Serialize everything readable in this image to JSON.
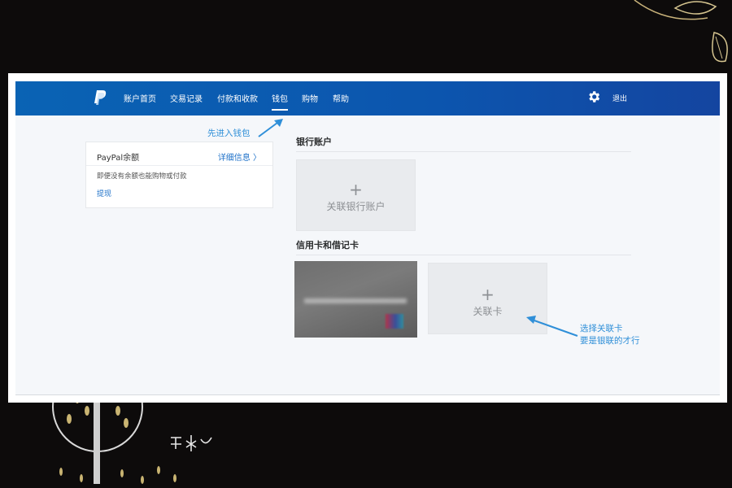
{
  "nav": {
    "items": [
      {
        "label": "账户首页"
      },
      {
        "label": "交易记录"
      },
      {
        "label": "付款和收款"
      },
      {
        "label": "钱包"
      },
      {
        "label": "购物"
      },
      {
        "label": "帮助"
      }
    ],
    "active_index": 3,
    "logout_label": "退出"
  },
  "balance": {
    "title": "PayPal余额",
    "details_link": "详细信息 〉",
    "description": "即便没有余额也能购物或付款",
    "withdraw_link": "提现"
  },
  "bank_section": {
    "title": "银行账户",
    "add_plus": "+",
    "add_label": "关联银行账户"
  },
  "cards_section": {
    "title": "信用卡和借记卡",
    "add_plus": "+",
    "add_label": "关联卡"
  },
  "annotations": {
    "wallet_hint": "先进入钱包",
    "card_hint_line1": "选择关联卡",
    "card_hint_line2": "要是银联的才行"
  },
  "colors": {
    "nav_blue": "#0a63b4",
    "link_blue": "#1f72c9",
    "annotation_blue": "#2f8fd8",
    "page_bg": "#f5f7fa",
    "tile_bg": "#e9ebee"
  },
  "icons": {
    "logo": "paypal-logo",
    "settings": "gear-icon",
    "details_chevron": "chevron-right-icon"
  }
}
